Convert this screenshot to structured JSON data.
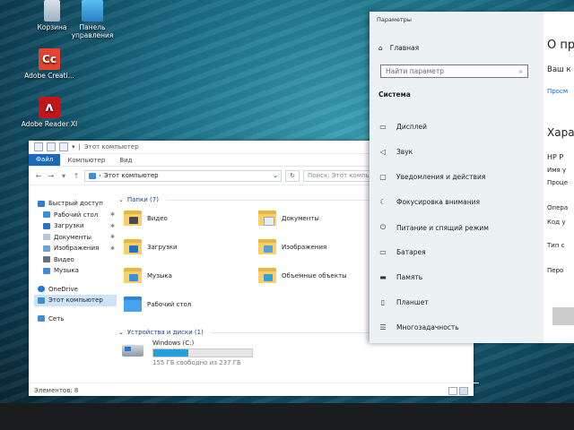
{
  "desktop": {
    "icons": [
      {
        "name": "recycle-bin",
        "label": "Корзина"
      },
      {
        "name": "control-panel",
        "label": "Панель управления"
      },
      {
        "name": "adobe-cc",
        "label": "Adobe Creati..."
      },
      {
        "name": "adobe-reader",
        "label": "Adobe Reader XI"
      }
    ]
  },
  "explorer": {
    "title": "Этот компьютер",
    "ribbon_tabs": [
      "Файл",
      "Компьютер",
      "Вид"
    ],
    "address": "Этот компьютер",
    "search_placeholder": "Поиск: Этот компьютер",
    "nav": {
      "quick_access": "Быстрый доступ",
      "quick_items": [
        "Рабочий стол",
        "Загрузки",
        "Документы",
        "Изображения",
        "Видео",
        "Музыка"
      ],
      "onedrive": "OneDrive",
      "this_pc": "Этот компьютер",
      "network": "Сеть"
    },
    "folders_header": "Папки (7)",
    "folders": [
      "Видео",
      "Документы",
      "Загрузки",
      "Изображения",
      "Музыка",
      "Объемные объекты",
      "Рабочий стол"
    ],
    "devices_header": "Устройства и диски (1)",
    "drive": {
      "name": "Windows (C:)",
      "free_text": "155 ГБ свободно из 237 ГБ",
      "used_fraction": 0.35
    },
    "status": "Элементов: 8"
  },
  "settings": {
    "title": "Параметры",
    "home": "Главная",
    "search_placeholder": "Найти параметр",
    "category": "Система",
    "items": [
      "Дисплей",
      "Звук",
      "Уведомления и действия",
      "Фокусировка внимания",
      "Питание и спящий режим",
      "Батарея",
      "Память",
      "Планшет",
      "Многозадачность"
    ],
    "right_texts": [
      "О пр",
      "Ваш к",
      "Просм",
      "Харак",
      "HP P",
      "Имя у",
      "Проце",
      "Опера",
      "Код у",
      "Тип с",
      "Перо"
    ]
  },
  "colors": {
    "accent": "#1a68b8",
    "folder": "#f7d06a",
    "bar": "#26a0da"
  }
}
